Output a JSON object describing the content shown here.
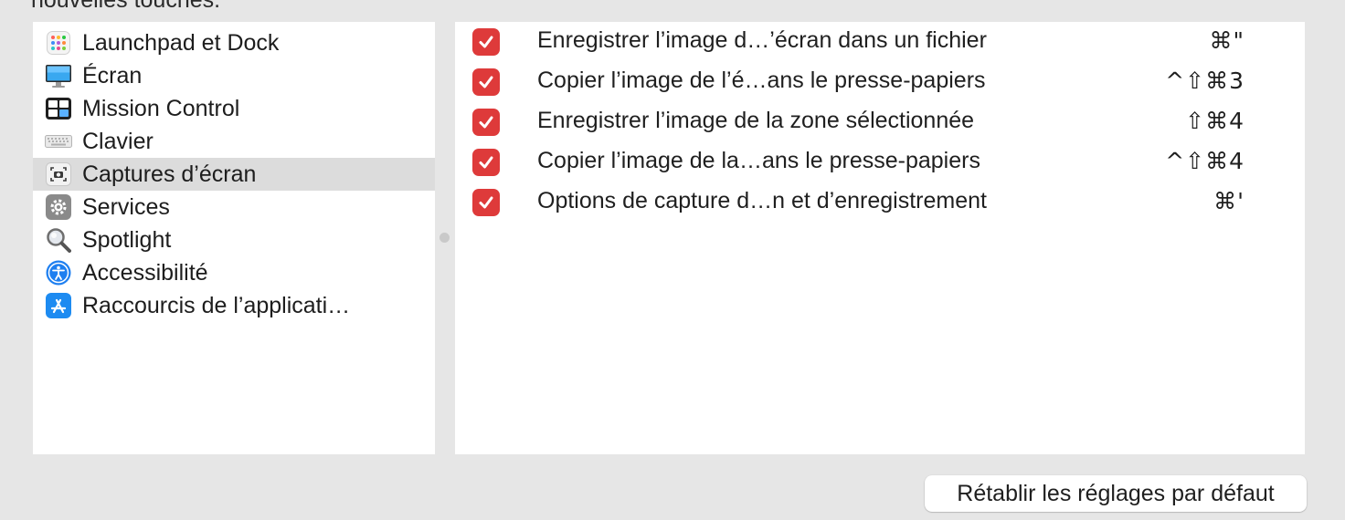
{
  "top_text": "nouvelles touches.",
  "sidebar": {
    "selected_index": 4,
    "items": [
      {
        "label": "Launchpad et Dock",
        "icon": "launchpad-icon"
      },
      {
        "label": "Écran",
        "icon": "display-icon"
      },
      {
        "label": "Mission Control",
        "icon": "mission-control-icon"
      },
      {
        "label": "Clavier",
        "icon": "keyboard-icon"
      },
      {
        "label": "Captures d’écran",
        "icon": "screenshot-icon"
      },
      {
        "label": "Services",
        "icon": "gear-icon"
      },
      {
        "label": "Spotlight",
        "icon": "magnifier-icon"
      },
      {
        "label": "Accessibilité",
        "icon": "accessibility-icon"
      },
      {
        "label": "Raccourcis de l’applicati…",
        "icon": "app-store-icon"
      }
    ]
  },
  "shortcuts": {
    "rows": [
      {
        "checked": true,
        "label": "Enregistrer l’image d…’écran dans un fichier",
        "shortcut": "⌘\""
      },
      {
        "checked": true,
        "label": "Copier l’image de l’é…ans le presse-papiers",
        "shortcut": "^⇧⌘3"
      },
      {
        "checked": true,
        "label": "Enregistrer l’image de la zone sélectionnée",
        "shortcut": "⇧⌘4"
      },
      {
        "checked": true,
        "label": "Copier l’image de la…ans le presse-papiers",
        "shortcut": "^⇧⌘4"
      },
      {
        "checked": true,
        "label": "Options de capture d…n et d’enregistrement",
        "shortcut": "⌘'"
      }
    ]
  },
  "footer": {
    "reset_label": "Rétablir les réglages par défaut"
  },
  "colors": {
    "checkbox": "#de3a3a",
    "selection": "#dcdcdc",
    "window_bg": "#e6e6e6"
  }
}
